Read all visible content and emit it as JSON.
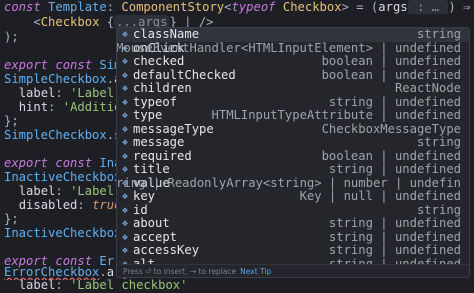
{
  "editor": {
    "lines": {
      "l1": {
        "kw": "const",
        "name": "Template",
        "colon": ":",
        "type": "ComponentStory",
        "lt": "<",
        "typeof": "typeof",
        "comp": "Checkbox",
        "rest": "> = (",
        "arg": "args",
        "hint": " : … ",
        "arrow": ") ⇒ ("
      },
      "l2": {
        "open": "<",
        "tag": "Checkbox",
        "brace": " {",
        "spread": "...args",
        "close": "}",
        "cursor": "|",
        "end": " />"
      },
      "l3": {
        "text": ");"
      },
      "l4": {
        "kw1": "export",
        "kw2": "const",
        "name": "SimpleC"
      },
      "l5": {
        "name": "SimpleCheckbox",
        "dot": ".",
        "prop": "args"
      },
      "l6": {
        "key": "label",
        "colon": ": ",
        "val": "'Label che"
      },
      "l7": {
        "key": "hint",
        "colon": ": ",
        "val": "'Additionna"
      },
      "l8": {
        "text": "};"
      },
      "l9": {
        "name": "SimpleCheckbox",
        "dot": ".",
        "prop": "story"
      },
      "l10": {
        "kw1": "export",
        "kw2": "const",
        "name": "Inactiv"
      },
      "l11": {
        "name": "InactiveCheckbox",
        "dot": ".",
        "prop": "ar"
      },
      "l12": {
        "key": "label",
        "colon": ": ",
        "val": "'Label che"
      },
      "l13": {
        "key": "disabled",
        "colon": ": ",
        "val": "true",
        "comma": ","
      },
      "l14": {
        "text": "};"
      },
      "l15": {
        "name": "InactiveCheckbox",
        "dot": ".",
        "prop": "sto"
      },
      "l16": {
        "kw1": "export",
        "kw2": "const",
        "name": "ErrorC"
      },
      "l17": {
        "name": "ErrorCheckbox",
        "dot": ".",
        "prop": "args"
      },
      "l18": {
        "key": "label",
        "colon": ": ",
        "val": "'Label checkbox'"
      }
    }
  },
  "suggest": {
    "icon_name": "symbol-field-icon",
    "items": [
      {
        "label": "className",
        "detail": "string"
      },
      {
        "label": "onClick",
        "detail": "MouseEventHandler<HTMLInputElement> | undefined"
      },
      {
        "label": "checked",
        "detail": "boolean | undefined"
      },
      {
        "label": "defaultChecked",
        "detail": "boolean | undefined"
      },
      {
        "label": "children",
        "detail": "ReactNode"
      },
      {
        "label": "typeof",
        "detail": "string | undefined"
      },
      {
        "label": "type",
        "detail": "HTMLInputTypeAttribute | undefined"
      },
      {
        "label": "messageType",
        "detail": "CheckboxMessageType"
      },
      {
        "label": "message",
        "detail": "string"
      },
      {
        "label": "required",
        "detail": "boolean | undefined"
      },
      {
        "label": "title",
        "detail": "string | undefined"
      },
      {
        "label": "value",
        "detail": "string | ReadonlyArray<string> | number | undefin"
      },
      {
        "label": "key",
        "detail": "Key | null | undefined"
      },
      {
        "label": "id",
        "detail": "string"
      },
      {
        "label": "about",
        "detail": "string | undefined"
      },
      {
        "label": "accept",
        "detail": "string | undefined"
      },
      {
        "label": "accessKey",
        "detail": "string | undefined"
      },
      {
        "label": "alt",
        "detail": "string | undefined"
      },
      {
        "label": "autoCapitalize",
        "detail": ""
      }
    ],
    "footer": {
      "text": "Press ⏎ to insert, → to replace",
      "tip": "Next Tip"
    }
  }
}
